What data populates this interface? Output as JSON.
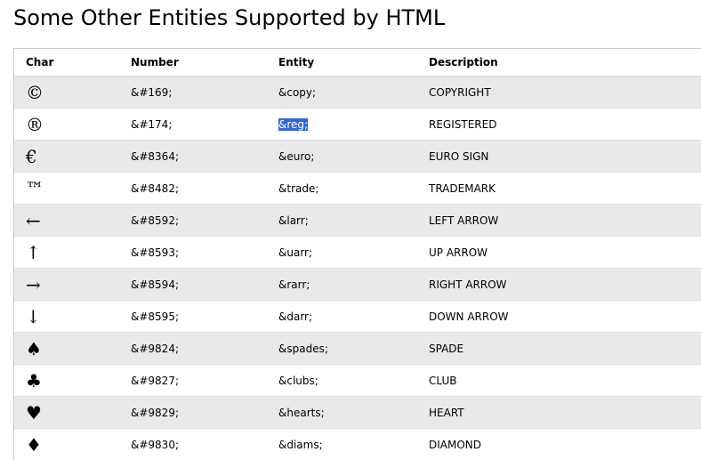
{
  "page": {
    "title": "Some Other Entities Supported by HTML"
  },
  "table": {
    "headers": {
      "char": "Char",
      "number": "Number",
      "entity": "Entity",
      "description": "Description"
    },
    "rows": [
      {
        "char": "©",
        "number": "&#169;",
        "entity": "&copy;",
        "description": "COPYRIGHT"
      },
      {
        "char": "®",
        "number": "&#174;",
        "entity": "&reg;",
        "description": "REGISTERED",
        "entity_selected": true
      },
      {
        "char": "€",
        "number": "&#8364;",
        "entity": "&euro;",
        "description": "EURO SIGN"
      },
      {
        "char": "™",
        "number": "&#8482;",
        "entity": "&trade;",
        "description": "TRADEMARK"
      },
      {
        "char": "←",
        "number": "&#8592;",
        "entity": "&larr;",
        "description": "LEFT ARROW"
      },
      {
        "char": "↑",
        "number": "&#8593;",
        "entity": "&uarr;",
        "description": "UP ARROW"
      },
      {
        "char": "→",
        "number": "&#8594;",
        "entity": "&rarr;",
        "description": "RIGHT ARROW"
      },
      {
        "char": "↓",
        "number": "&#8595;",
        "entity": "&darr;",
        "description": "DOWN ARROW"
      },
      {
        "char": "♠",
        "number": "&#9824;",
        "entity": "&spades;",
        "description": "SPADE"
      },
      {
        "char": "♣",
        "number": "&#9827;",
        "entity": "&clubs;",
        "description": "CLUB"
      },
      {
        "char": "♥",
        "number": "&#9829;",
        "entity": "&hearts;",
        "description": "HEART"
      },
      {
        "char": "♦",
        "number": "&#9830;",
        "entity": "&diams;",
        "description": " DIAMOND"
      }
    ]
  },
  "colors": {
    "row_shade": "#e7e9eb",
    "selection": "#3367d6"
  }
}
